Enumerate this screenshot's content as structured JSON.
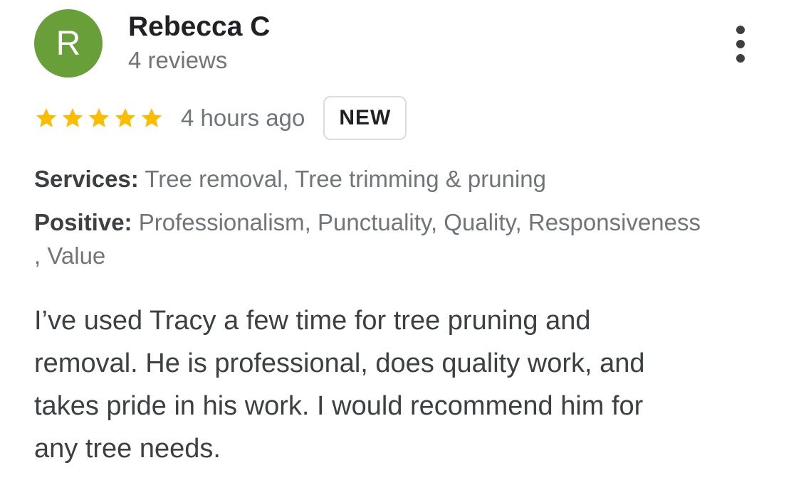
{
  "reviewer": {
    "initial": "R",
    "name": "Rebecca C",
    "review_count": "4 reviews",
    "avatar_color": "#689f38"
  },
  "rating": {
    "stars": 5,
    "max_stars": 5,
    "star_color": "#fbbc04",
    "time_ago": "4 hours ago",
    "badge": "NEW"
  },
  "services": {
    "label": "Services:",
    "value": "Tree removal, Tree trimming & pruning"
  },
  "positive": {
    "label": "Positive:",
    "value_line1": "Professionalism, Punctuality, Quality, Responsiveness",
    "value_line2": ", Value"
  },
  "review_text": {
    "line1": "I’ve used Tracy a few time for tree pruning and",
    "line2": "removal. He is professional, does quality work, and",
    "line3": "takes pride in his work. I would recommend him for",
    "line4": "any tree needs."
  },
  "menu": {
    "icon": "more-vert-icon"
  }
}
